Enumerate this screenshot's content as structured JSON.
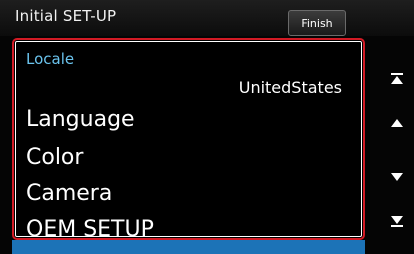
{
  "header": {
    "title": "Initial SET-UP",
    "finish_label": "Finish"
  },
  "list": {
    "locale": {
      "label": "Locale",
      "value": "UnitedStates"
    },
    "items": [
      {
        "label": "Language"
      },
      {
        "label": "Color"
      },
      {
        "label": "Camera"
      },
      {
        "label": "OEM SETUP"
      }
    ]
  },
  "scroll": {
    "icons": [
      "scroll-to-top-icon",
      "scroll-up-icon",
      "scroll-down-icon",
      "scroll-to-bottom-icon"
    ]
  },
  "colors": {
    "accent_label": "#6bc4ee",
    "selection_border": "#d21a24",
    "bottom_bar": "#1c73b7"
  }
}
